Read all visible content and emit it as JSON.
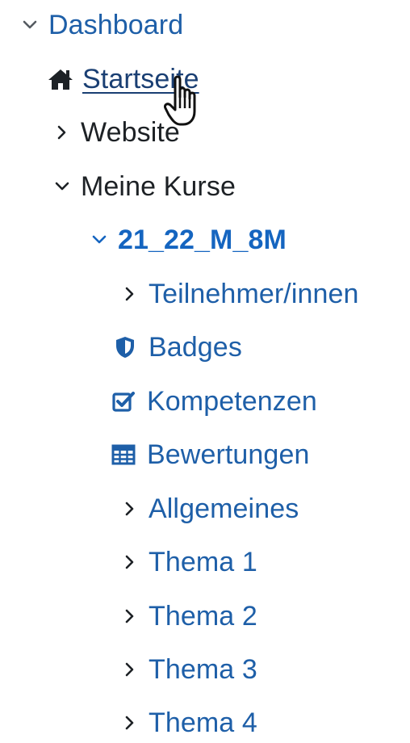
{
  "nav": {
    "dashboard": {
      "label": "Dashboard",
      "icon": "chevron-down-icon",
      "expanded": true
    },
    "startseite": {
      "label": "Startseite",
      "icon": "home-icon",
      "hovered": true
    },
    "website": {
      "label": "Website",
      "icon": "chevron-right-icon",
      "expanded": false
    },
    "meine_kurse": {
      "label": "Meine Kurse",
      "icon": "chevron-down-icon",
      "expanded": true
    },
    "course": {
      "label": "21_22_M_8M",
      "icon": "chevron-down-icon",
      "expanded": true,
      "items": [
        {
          "label": "Teilnehmer/innen",
          "icon": "chevron-right-icon"
        },
        {
          "label": "Badges",
          "icon": "shield-icon"
        },
        {
          "label": "Kompetenzen",
          "icon": "checkbox-icon"
        },
        {
          "label": "Bewertungen",
          "icon": "table-icon"
        },
        {
          "label": "Allgemeines",
          "icon": "chevron-right-icon"
        },
        {
          "label": "Thema 1",
          "icon": "chevron-right-icon"
        },
        {
          "label": "Thema 2",
          "icon": "chevron-right-icon"
        },
        {
          "label": "Thema 3",
          "icon": "chevron-right-icon"
        },
        {
          "label": "Thema 4",
          "icon": "chevron-right-icon"
        }
      ]
    }
  },
  "colors": {
    "link_blue": "#1e5fa8",
    "active_course": "#1565c0",
    "text_dark": "#1d2125",
    "hover_link": "#1a3f73"
  },
  "cursor": {
    "icon": "hand-pointer-cursor-icon"
  }
}
